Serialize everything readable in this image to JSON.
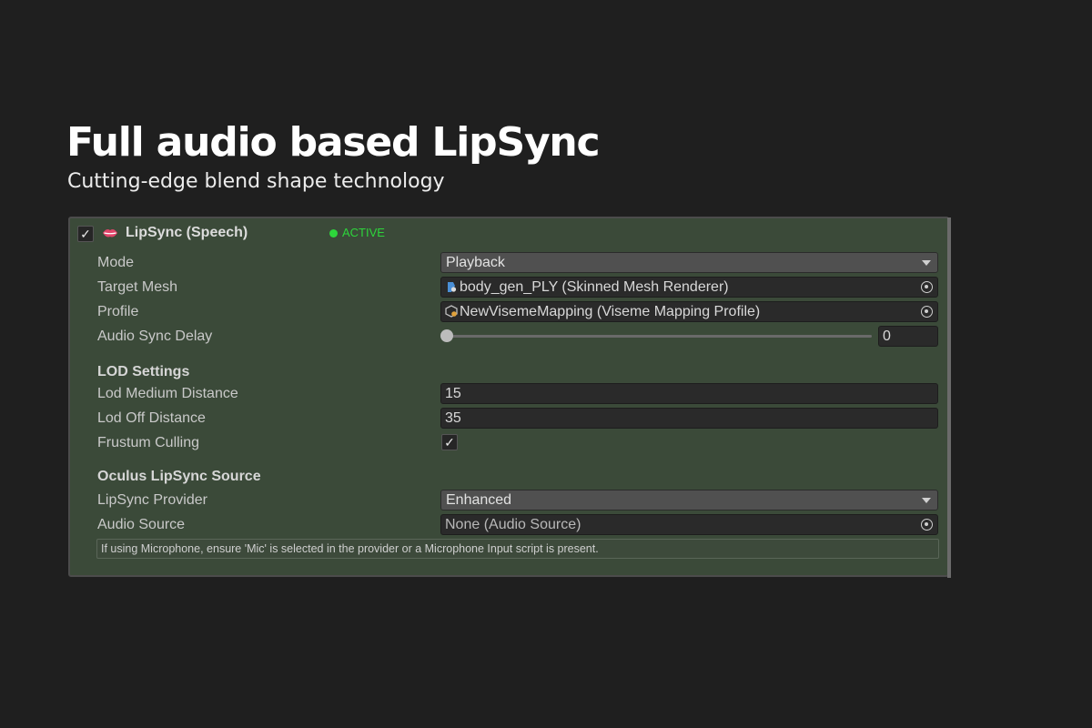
{
  "hero": {
    "title": "Full audio based LipSync",
    "subtitle": "Cutting-edge blend shape technology"
  },
  "component": {
    "enabled": true,
    "icon": "lips-icon",
    "title": "LipSync (Speech)",
    "status": "ACTIVE",
    "status_color": "#2dd53b",
    "panel_color": "#3b4a39"
  },
  "fields": {
    "mode": {
      "label": "Mode",
      "value": "Playback"
    },
    "target_mesh": {
      "label": "Target Mesh",
      "value": "body_gen_PLY (Skinned Mesh Renderer)",
      "icon": "skinned-mesh-icon"
    },
    "profile": {
      "label": "Profile",
      "value": "NewVisemeMapping (Viseme Mapping Profile)",
      "icon": "viseme-profile-icon"
    },
    "audio_sync_delay": {
      "label": "Audio Sync Delay",
      "value": "0",
      "slider_fraction": 0
    }
  },
  "lod": {
    "header": "LOD Settings",
    "medium": {
      "label": "Lod Medium Distance",
      "value": "15"
    },
    "off": {
      "label": "Lod Off Distance",
      "value": "35"
    },
    "frustum": {
      "label": "Frustum Culling",
      "checked": true
    }
  },
  "oculus": {
    "header": "Oculus LipSync Source",
    "provider": {
      "label": "LipSync Provider",
      "value": "Enhanced"
    },
    "audio_source": {
      "label": "Audio Source",
      "value": "None (Audio Source)"
    },
    "help": "If using Microphone, ensure 'Mic' is selected in the provider or a Microphone Input script is present."
  }
}
